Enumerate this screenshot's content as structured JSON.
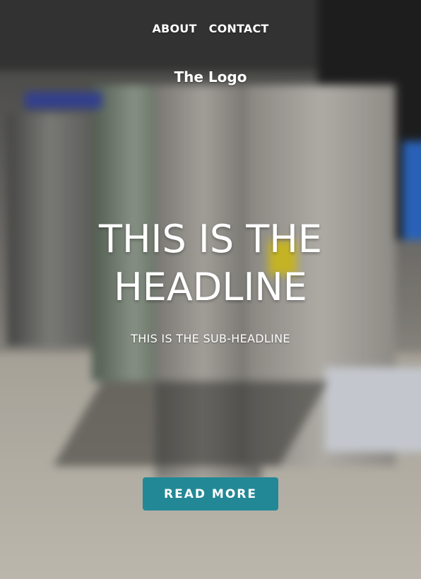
{
  "nav": {
    "items": [
      {
        "label": "ABOUT"
      },
      {
        "label": "CONTACT"
      }
    ]
  },
  "logo": {
    "text": "The Logo"
  },
  "hero": {
    "headline_lines": [
      "THIS IS THE",
      "HEADLINE"
    ],
    "subheadline": "THIS IS THE SUB-HEADLINE",
    "cta_label": "READ MORE",
    "background_image": "blurred-appliance-showroom"
  },
  "colors": {
    "cta_background": "#238896",
    "text": "#ffffff"
  }
}
